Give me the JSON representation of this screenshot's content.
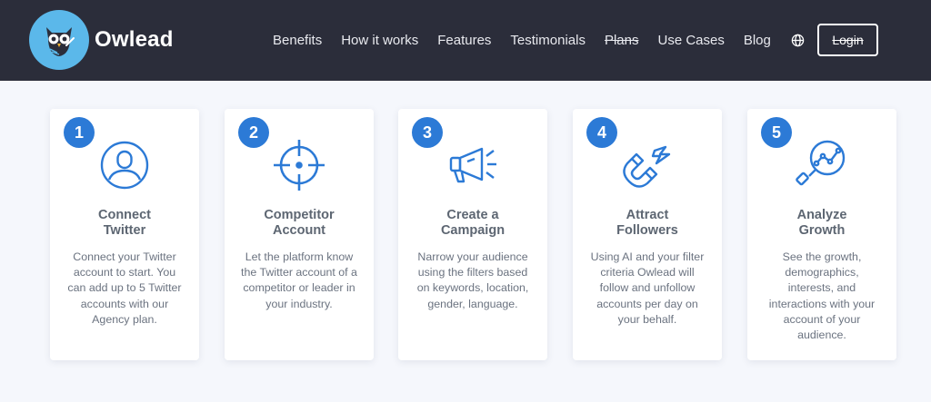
{
  "brand": {
    "name": "Owlead",
    "logo_icon": "owl-icon"
  },
  "nav": {
    "links": [
      "Benefits",
      "How it works",
      "Features",
      "Testimonials",
      "Plans",
      "Use Cases",
      "Blog"
    ],
    "globe_icon": "globe-icon",
    "login_label": "Login"
  },
  "steps": [
    {
      "number": "1",
      "title": "Connect Twitter",
      "icon": "user-circle-icon",
      "description": "Connect your Twitter account to start. You can add up to 5 Twitter accounts with our Agency plan."
    },
    {
      "number": "2",
      "title": "Competitor Account",
      "icon": "crosshair-icon",
      "description": "Let the platform know the Twitter account of a competitor or leader in your industry."
    },
    {
      "number": "3",
      "title": "Create a Campaign",
      "icon": "megaphone-icon",
      "description": "Narrow your audience using the filters based on keywords, location, gender, language."
    },
    {
      "number": "4",
      "title": "Attract Followers",
      "icon": "magnet-icon",
      "description": "Using AI and your filter criteria Owlead will follow and unfollow accounts per day on your behalf."
    },
    {
      "number": "5",
      "title": "Analyze Growth",
      "icon": "analytics-magnifier-icon",
      "description": "See the growth, demographics, interests, and interactions with your account of your audience."
    }
  ],
  "colors": {
    "navbar": "#2b2d3a",
    "accent": "#2c7ad6",
    "logo_bg": "#5bb8ea",
    "page_bg": "#f5f7fc"
  }
}
